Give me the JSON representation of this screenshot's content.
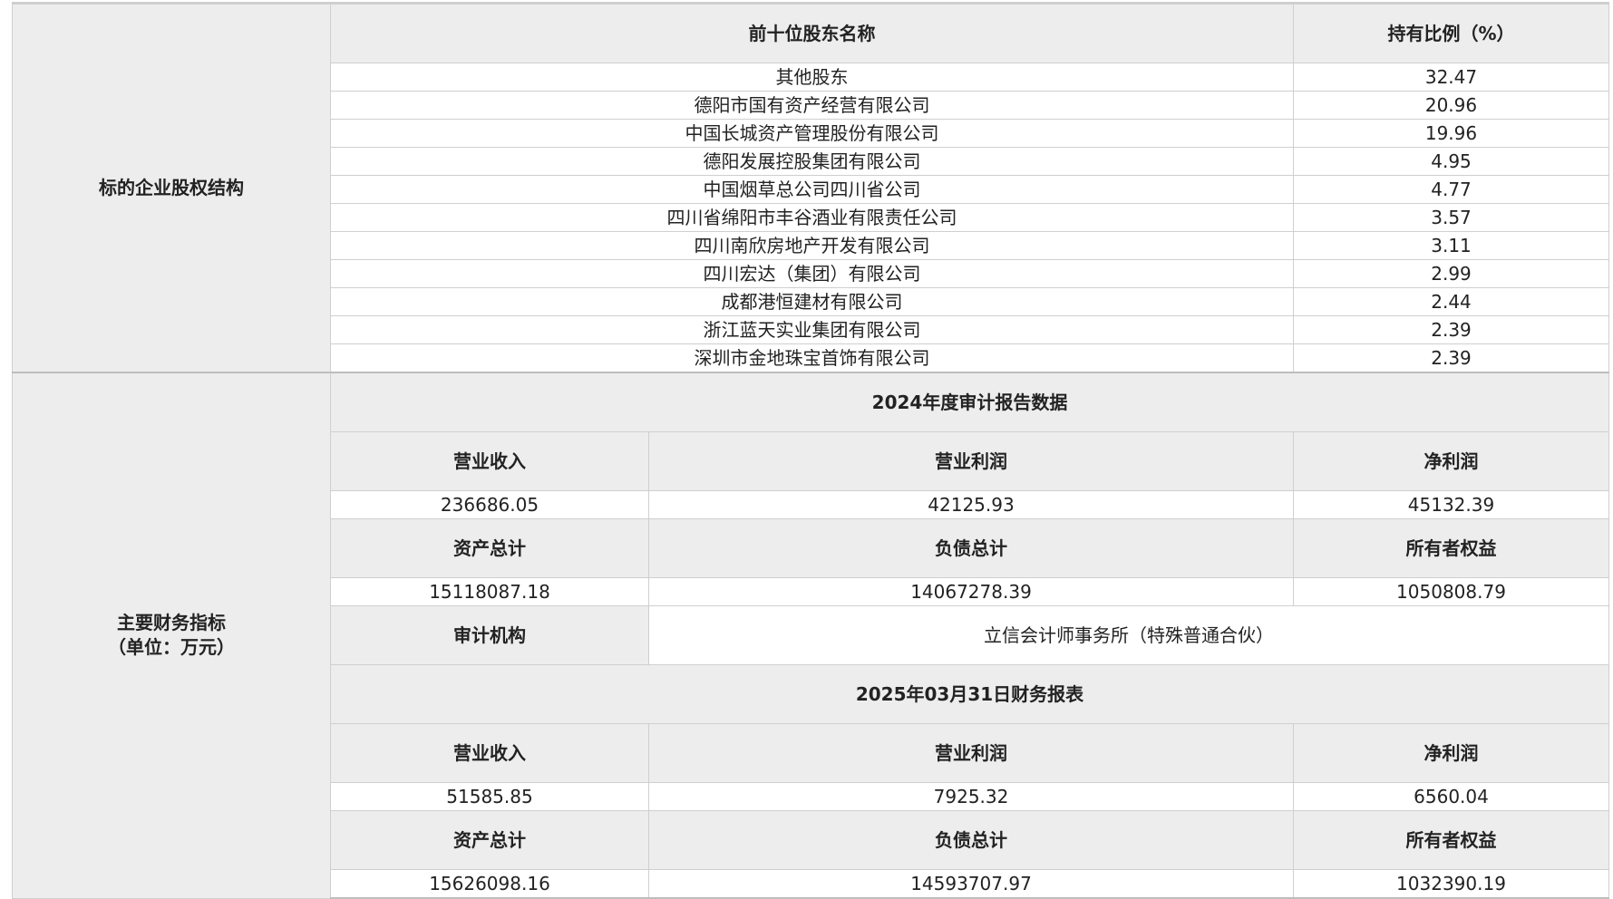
{
  "equity": {
    "label": "标的企业股权结构",
    "headers": {
      "name": "前十位股东名称",
      "ratio": "持有比例（%）"
    },
    "rows": [
      {
        "name": "其他股东",
        "ratio": "32.47"
      },
      {
        "name": "德阳市国有资产经营有限公司",
        "ratio": "20.96"
      },
      {
        "name": "中国长城资产管理股份有限公司",
        "ratio": "19.96"
      },
      {
        "name": "德阳发展控股集团有限公司",
        "ratio": "4.95"
      },
      {
        "name": "中国烟草总公司四川省公司",
        "ratio": "4.77"
      },
      {
        "name": "四川省绵阳市丰谷酒业有限责任公司",
        "ratio": "3.57"
      },
      {
        "name": "四川南欣房地产开发有限公司",
        "ratio": "3.11"
      },
      {
        "name": "四川宏达（集团）有限公司",
        "ratio": "2.99"
      },
      {
        "name": "成都港恒建材有限公司",
        "ratio": "2.44"
      },
      {
        "name": "浙江蓝天实业集团有限公司",
        "ratio": "2.39"
      },
      {
        "name": "深圳市金地珠宝首饰有限公司",
        "ratio": "2.39"
      }
    ]
  },
  "finance": {
    "label_line1": "主要财务指标",
    "label_line2": "（单位：万元）",
    "audit2024": {
      "title": "2024年度审计报告数据",
      "h_revenue": "营业收入",
      "h_operating_profit": "营业利润",
      "h_net_profit": "净利润",
      "revenue": "236686.05",
      "operating_profit": "42125.93",
      "net_profit": "45132.39",
      "h_total_assets": "资产总计",
      "h_total_liabilities": "负债总计",
      "h_owner_equity": "所有者权益",
      "total_assets": "15118087.18",
      "total_liabilities": "14067278.39",
      "owner_equity": "1050808.79",
      "h_auditor": "审计机构",
      "auditor": "立信会计师事务所（特殊普通合伙）"
    },
    "q2025": {
      "title": "2025年03月31日财务报表",
      "h_revenue": "营业收入",
      "h_operating_profit": "营业利润",
      "h_net_profit": "净利润",
      "revenue": "51585.85",
      "operating_profit": "7925.32",
      "net_profit": "6560.04",
      "h_total_assets": "资产总计",
      "h_total_liabilities": "负债总计",
      "h_owner_equity": "所有者权益",
      "total_assets": "15626098.16",
      "total_liabilities": "14593707.97",
      "owner_equity": "1032390.19"
    }
  }
}
